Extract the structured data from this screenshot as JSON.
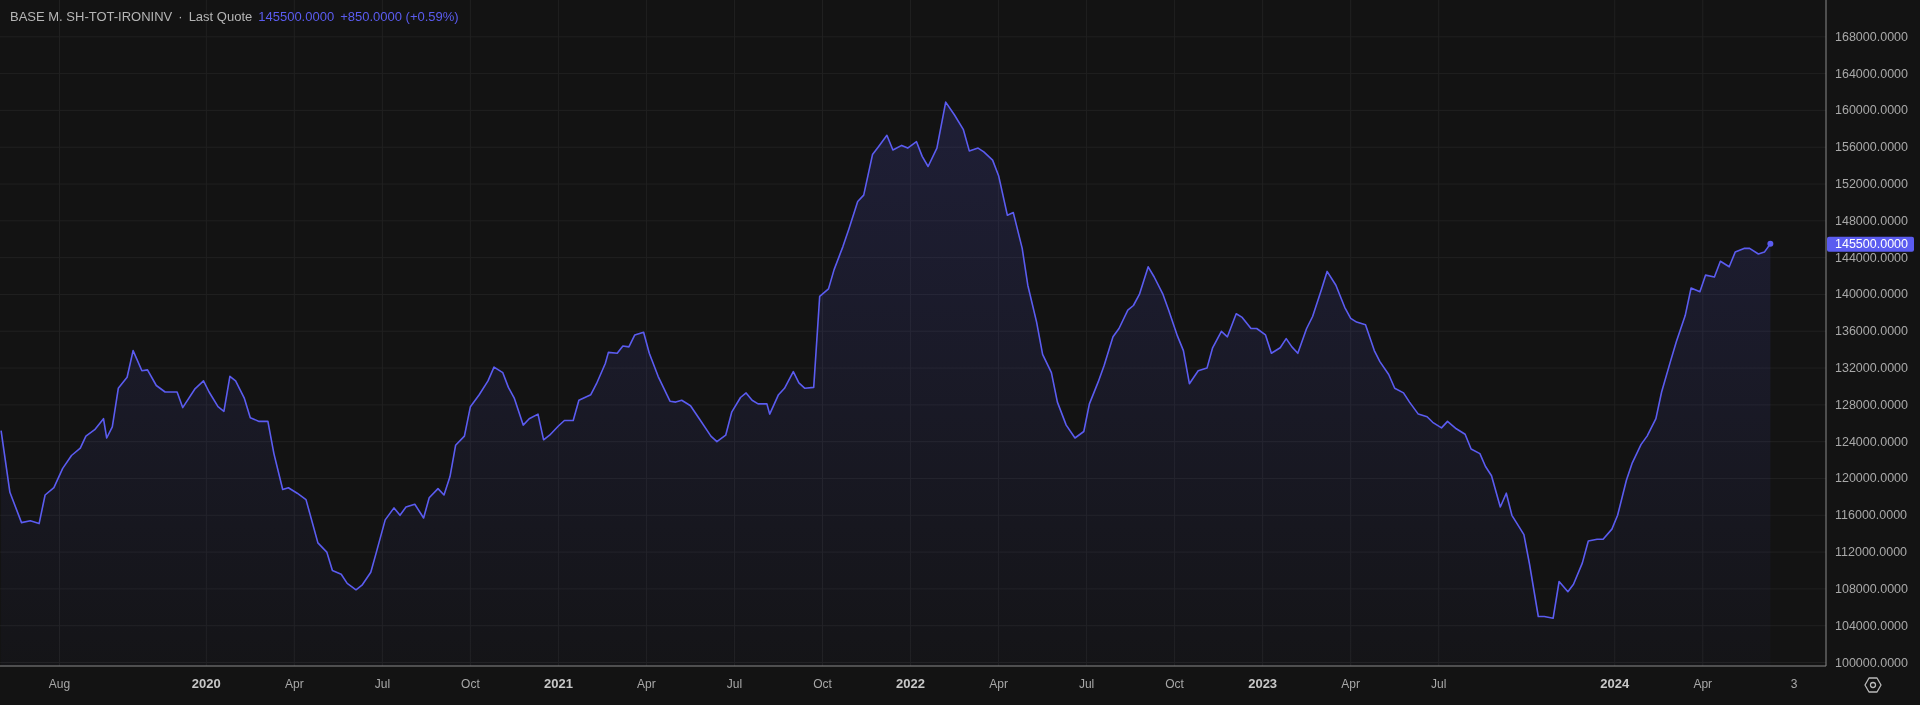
{
  "header": {
    "separator": "·",
    "quote_type": "Last Quote",
    "price": "145500.0000",
    "change": "+850.0000 (+0.59%)"
  },
  "price_badge": "145500.0000",
  "time_axis_end_label": "3",
  "chart_data": {
    "type": "area",
    "grid": true,
    "xlim": [
      2019.414,
      2024.6
    ],
    "ylim": [
      99620,
      172000
    ],
    "yticks": [
      {
        "value": 100000,
        "label": "100000.0000"
      },
      {
        "value": 104000,
        "label": "104000.0000"
      },
      {
        "value": 108000,
        "label": "108000.0000"
      },
      {
        "value": 112000,
        "label": "112000.0000"
      },
      {
        "value": 116000,
        "label": "116000.0000"
      },
      {
        "value": 120000,
        "label": "120000.0000"
      },
      {
        "value": 124000,
        "label": "124000.0000"
      },
      {
        "value": 128000,
        "label": "128000.0000"
      },
      {
        "value": 132000,
        "label": "132000.0000"
      },
      {
        "value": 136000,
        "label": "136000.0000"
      },
      {
        "value": 140000,
        "label": "140000.0000"
      },
      {
        "value": 144000,
        "label": "144000.0000"
      },
      {
        "value": 148000,
        "label": "148000.0000"
      },
      {
        "value": 152000,
        "label": "152000.0000"
      },
      {
        "value": 156000,
        "label": "156000.0000"
      },
      {
        "value": 160000,
        "label": "160000.0000"
      },
      {
        "value": 164000,
        "label": "164000.0000"
      },
      {
        "value": 168000,
        "label": "168000.0000"
      }
    ],
    "xticks": [
      {
        "value": 2019.583,
        "label": "Aug"
      },
      {
        "value": 2020,
        "label": "2020"
      },
      {
        "value": 2020.25,
        "label": "Apr"
      },
      {
        "value": 2020.5,
        "label": "Jul"
      },
      {
        "value": 2020.75,
        "label": "Oct"
      },
      {
        "value": 2021,
        "label": "2021"
      },
      {
        "value": 2021.25,
        "label": "Apr"
      },
      {
        "value": 2021.5,
        "label": "Jul"
      },
      {
        "value": 2021.75,
        "label": "Oct"
      },
      {
        "value": 2022,
        "label": "2022"
      },
      {
        "value": 2022.25,
        "label": "Apr"
      },
      {
        "value": 2022.5,
        "label": "Jul"
      },
      {
        "value": 2022.75,
        "label": "Oct"
      },
      {
        "value": 2023,
        "label": "2023"
      },
      {
        "value": 2023.25,
        "label": "Apr"
      },
      {
        "value": 2023.5,
        "label": "Jul"
      },
      {
        "value": 2024,
        "label": "2024"
      },
      {
        "value": 2024.25,
        "label": "Apr"
      }
    ],
    "x": [
      2019.417,
      2019.442,
      2019.475,
      2019.5,
      2019.525,
      2019.542,
      2019.567,
      2019.592,
      2019.617,
      2019.642,
      2019.658,
      2019.683,
      2019.708,
      2019.717,
      2019.733,
      2019.75,
      2019.775,
      2019.792,
      2019.817,
      2019.833,
      2019.858,
      2019.883,
      2019.917,
      2019.933,
      2019.967,
      2019.992,
      2020.008,
      2020.033,
      2020.05,
      2020.067,
      2020.083,
      2020.108,
      2020.125,
      2020.15,
      2020.175,
      2020.192,
      2020.217,
      2020.233,
      2020.258,
      2020.283,
      2020.317,
      2020.342,
      2020.358,
      2020.383,
      2020.4,
      2020.425,
      2020.442,
      2020.467,
      2020.483,
      2020.508,
      2020.533,
      2020.55,
      2020.567,
      2020.592,
      2020.617,
      2020.633,
      2020.658,
      2020.675,
      2020.692,
      2020.708,
      2020.733,
      2020.75,
      2020.775,
      2020.8,
      2020.817,
      2020.842,
      2020.858,
      2020.875,
      2020.9,
      2020.917,
      2020.942,
      2020.958,
      2020.975,
      2021.0,
      2021.017,
      2021.042,
      2021.058,
      2021.092,
      2021.108,
      2021.133,
      2021.142,
      2021.167,
      2021.183,
      2021.2,
      2021.217,
      2021.242,
      2021.258,
      2021.283,
      2021.317,
      2021.333,
      2021.35,
      2021.375,
      2021.4,
      2021.433,
      2021.45,
      2021.475,
      2021.492,
      2021.517,
      2021.533,
      2021.55,
      2021.567,
      2021.592,
      2021.6,
      2021.625,
      2021.642,
      2021.667,
      2021.683,
      2021.7,
      2021.725,
      2021.742,
      2021.767,
      2021.783,
      2021.808,
      2021.825,
      2021.85,
      2021.867,
      2021.892,
      2021.908,
      2021.933,
      2021.95,
      2021.975,
      2021.992,
      2022.017,
      2022.033,
      2022.05,
      2022.075,
      2022.1,
      2022.125,
      2022.15,
      2022.167,
      2022.192,
      2022.208,
      2022.233,
      2022.25,
      2022.275,
      2022.292,
      2022.317,
      2022.333,
      2022.358,
      2022.375,
      2022.4,
      2022.417,
      2022.442,
      2022.467,
      2022.492,
      2022.508,
      2022.533,
      2022.55,
      2022.575,
      2022.592,
      2022.617,
      2022.633,
      2022.65,
      2022.675,
      2022.692,
      2022.717,
      2022.733,
      2022.758,
      2022.775,
      2022.792,
      2022.817,
      2022.842,
      2022.858,
      2022.883,
      2022.9,
      2022.925,
      2022.942,
      2022.967,
      2022.983,
      2023.008,
      2023.025,
      2023.05,
      2023.067,
      2023.083,
      2023.1,
      2023.125,
      2023.142,
      2023.167,
      2023.183,
      2023.208,
      2023.233,
      2023.25,
      2023.267,
      2023.292,
      2023.317,
      2023.333,
      2023.358,
      2023.375,
      2023.4,
      2023.417,
      2023.442,
      2023.467,
      2023.483,
      2023.508,
      2023.525,
      2023.55,
      2023.575,
      2023.592,
      2023.617,
      2023.633,
      2023.65,
      2023.675,
      2023.692,
      2023.708,
      2023.742,
      2023.758,
      2023.783,
      2023.8,
      2023.825,
      2023.842,
      2023.867,
      2023.883,
      2023.908,
      2023.925,
      2023.95,
      2023.967,
      2023.992,
      2024.008,
      2024.033,
      2024.05,
      2024.075,
      2024.092,
      2024.117,
      2024.133,
      2024.158,
      2024.175,
      2024.2,
      2024.217,
      2024.242,
      2024.258,
      2024.283,
      2024.3,
      2024.325,
      2024.342,
      2024.367,
      2024.383,
      2024.408,
      2024.425,
      2024.442
    ],
    "series": [
      {
        "name": "BASE M. SH-TOT-IRONINV",
        "color": "#5b5cf0",
        "values": [
          125200,
          118500,
          115200,
          115400,
          115100,
          118200,
          119000,
          121100,
          122500,
          123300,
          124600,
          125300,
          126500,
          124400,
          125600,
          129800,
          131000,
          133900,
          131700,
          131800,
          130100,
          129400,
          129400,
          127700,
          129700,
          130600,
          129400,
          127800,
          127300,
          131100,
          130600,
          128700,
          126600,
          126200,
          126200,
          122700,
          118800,
          119000,
          118400,
          117700,
          113000,
          112000,
          110000,
          109600,
          108600,
          107900,
          108400,
          109800,
          112000,
          115500,
          116800,
          116000,
          116900,
          117200,
          115700,
          117900,
          118900,
          118200,
          120200,
          123600,
          124600,
          127800,
          129100,
          130600,
          132100,
          131500,
          129900,
          128700,
          125800,
          126500,
          127000,
          124200,
          124700,
          125700,
          126300,
          126300,
          128500,
          129100,
          130300,
          132500,
          133700,
          133600,
          134400,
          134300,
          135600,
          135900,
          133600,
          131100,
          128400,
          128300,
          128500,
          127900,
          126500,
          124600,
          124000,
          124700,
          127200,
          128800,
          129300,
          128500,
          128100,
          128100,
          127000,
          129100,
          129800,
          131600,
          130400,
          129800,
          129900,
          139800,
          140600,
          142700,
          145200,
          147100,
          150100,
          150800,
          155200,
          156000,
          157300,
          155700,
          156200,
          155900,
          156600,
          155000,
          153900,
          155900,
          160900,
          159500,
          157900,
          155600,
          155900,
          155500,
          154600,
          152900,
          148600,
          148900,
          145000,
          141000,
          137000,
          133500,
          131500,
          128300,
          125800,
          124400,
          125100,
          128100,
          130500,
          132300,
          135400,
          136300,
          138300,
          138800,
          140000,
          143000,
          141900,
          140000,
          138300,
          135500,
          133900,
          130300,
          131700,
          132000,
          134200,
          136000,
          135400,
          137900,
          137500,
          136300,
          136300,
          135600,
          133600,
          134200,
          135200,
          134300,
          133600,
          136300,
          137600,
          140500,
          142500,
          141000,
          138600,
          137400,
          137000,
          136700,
          133900,
          132700,
          131300,
          129800,
          129300,
          128300,
          127000,
          126700,
          126100,
          125500,
          126200,
          125400,
          124800,
          123200,
          122700,
          121300,
          120300,
          116900,
          118400,
          116000,
          113900,
          110700,
          105000,
          105000,
          104800,
          108800,
          107700,
          108500,
          110800,
          113200,
          113400,
          113400,
          114500,
          116000,
          119800,
          121700,
          123700,
          124600,
          126500,
          129400,
          132700,
          134900,
          137700,
          140700,
          140300,
          142100,
          141900,
          143600,
          143000,
          144600,
          145000,
          145000,
          144400,
          144600,
          145500
        ]
      }
    ]
  }
}
